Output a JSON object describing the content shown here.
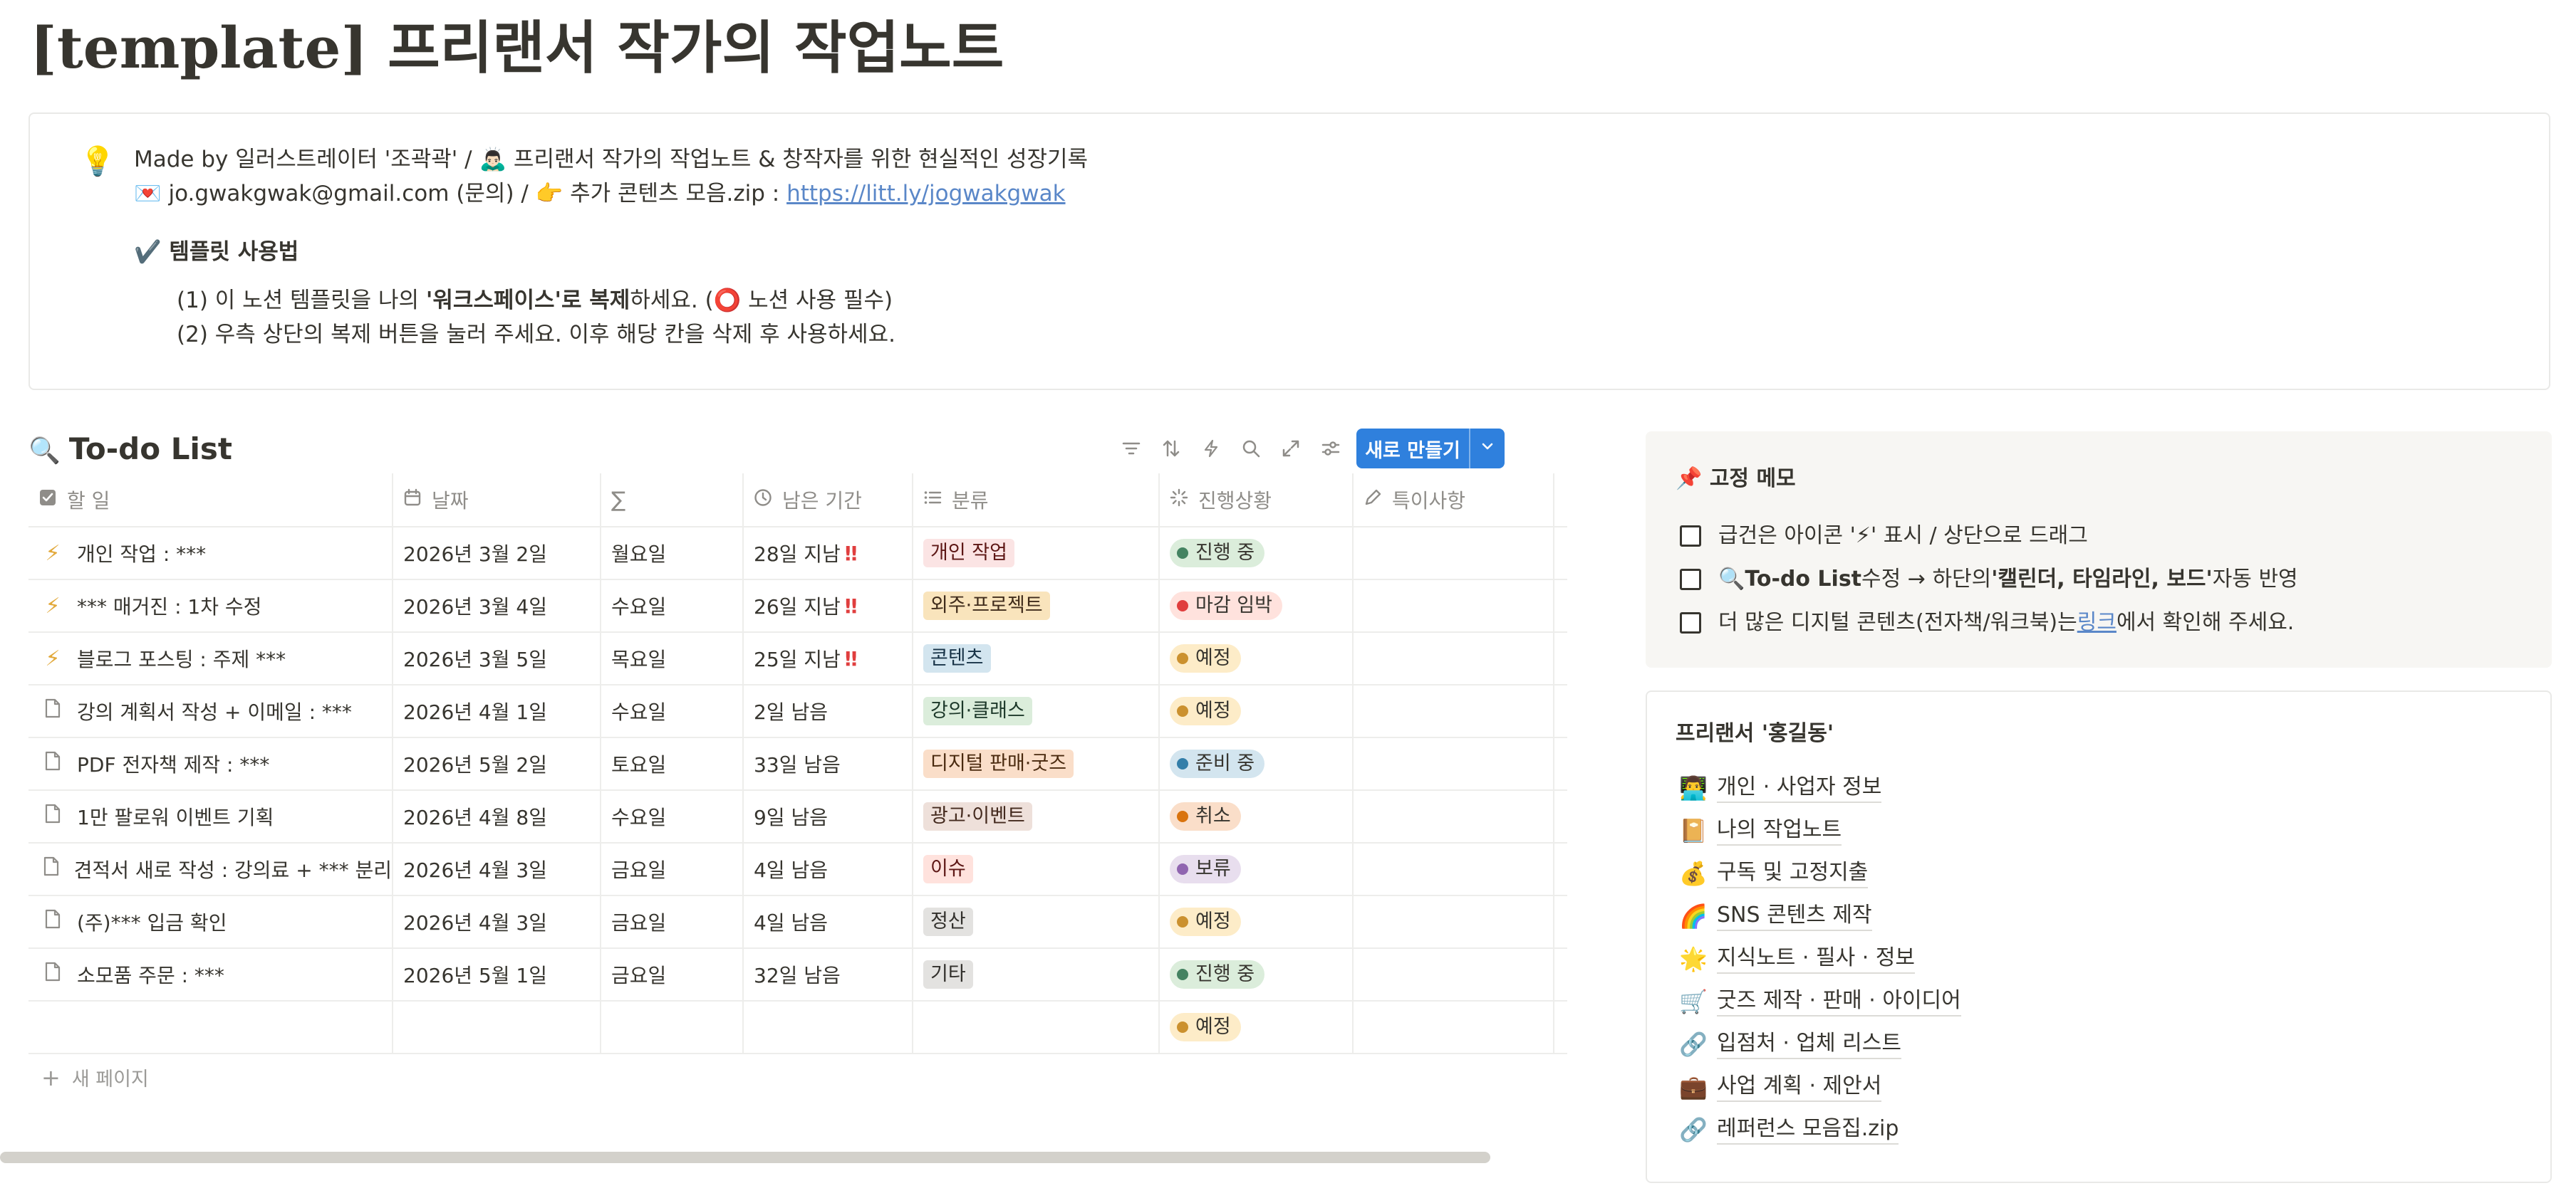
{
  "page": {
    "title": "[template] 프리랜서 작가의 작업노트"
  },
  "callout": {
    "icon": "💡",
    "line1": "Made by 일러스트레이터 '조곽곽' / 🙇🏻‍♂️ 프리랜서 작가의 작업노트 & 창작자를 위한 현실적인 성장기록",
    "line2_prefix": "💌 jo.gwakgwak@gmail.com (문의) / 👉 추가 콘텐츠 모음.zip : ",
    "line2_link": "https://litt.ly/jogwakgwak",
    "guide_title": "✔️ 템플릿 사용법",
    "step1_a": "(1) 이 노션 템플릿을 나의 ",
    "step1_b": "'워크스페이스'로 복제",
    "step1_c": "하세요. (⭕ 노션 사용 필수)",
    "step2": "(2) 우측 상단의 복제 버튼을 눌러 주세요. 이후 해당 칸을 삭제 후 사용하세요."
  },
  "todo": {
    "icon": "🔍",
    "title": "To-do List",
    "toolbar_icons": [
      "filter-icon",
      "sort-icon",
      "bolt-icon",
      "search-icon",
      "expand-icon",
      "settings-icon"
    ],
    "new_button": "새로 만들기",
    "columns": [
      "할 일",
      "날짜",
      "∑",
      "남은 기간",
      "분류",
      "진행상황",
      "특이사항"
    ],
    "rows": [
      {
        "icon": "bolt",
        "task": "개인 작업 : ***",
        "date": "2026년 3월 2일",
        "day": "월요일",
        "remain": "28일 지남",
        "urgent": true,
        "category": "개인 작업",
        "status": "진행 중"
      },
      {
        "icon": "bolt",
        "task": "*** 매거진 : 1차 수정",
        "date": "2026년 3월 4일",
        "day": "수요일",
        "remain": "26일 지남",
        "urgent": true,
        "category": "외주·프로젝트",
        "status": "마감 임박"
      },
      {
        "icon": "bolt",
        "task": "블로그 포스팅 : 주제 ***",
        "date": "2026년 3월 5일",
        "day": "목요일",
        "remain": "25일 지남",
        "urgent": true,
        "category": "콘텐츠",
        "status": "예정"
      },
      {
        "icon": "doc",
        "task": "강의 계획서 작성 + 이메일 : ***",
        "date": "2026년 4월 1일",
        "day": "수요일",
        "remain": "2일 남음",
        "urgent": false,
        "category": "강의·클래스",
        "status": "예정"
      },
      {
        "icon": "doc",
        "task": "PDF 전자책 제작 : ***",
        "date": "2026년 5월 2일",
        "day": "토요일",
        "remain": "33일 남음",
        "urgent": false,
        "category": "디지털 판매·굿즈",
        "status": "준비 중"
      },
      {
        "icon": "doc",
        "task": "1만 팔로워 이벤트 기획",
        "date": "2026년 4월 8일",
        "day": "수요일",
        "remain": "9일 남음",
        "urgent": false,
        "category": "광고·이벤트",
        "status": "취소"
      },
      {
        "icon": "doc",
        "task": "견적서 새로 작성 : 강의료 + *** 분리",
        "date": "2026년 4월 3일",
        "day": "금요일",
        "remain": "4일 남음",
        "urgent": false,
        "category": "이슈",
        "status": "보류"
      },
      {
        "icon": "doc",
        "task": "(주)*** 입금 확인",
        "date": "2026년 4월 3일",
        "day": "금요일",
        "remain": "4일 남음",
        "urgent": false,
        "category": "정산",
        "status": "예정"
      },
      {
        "icon": "doc",
        "task": "소모품 주문 : ***",
        "date": "2026년 5월 1일",
        "day": "금요일",
        "remain": "32일 남음",
        "urgent": false,
        "category": "기타",
        "status": "진행 중"
      },
      {
        "icon": "",
        "task": "",
        "date": "",
        "day": "",
        "remain": "",
        "urgent": false,
        "category": "",
        "status": "예정"
      }
    ],
    "new_page": "새 페이지",
    "category_colors": {
      "개인 작업": {
        "bg": "#fbe4e4",
        "fg": "#5d1715"
      },
      "외주·프로젝트": {
        "bg": "#f9e4bc",
        "fg": "#402c1b"
      },
      "콘텐츠": {
        "bg": "#d3e5ef",
        "fg": "#183347"
      },
      "강의·클래스": {
        "bg": "#dbeddb",
        "fg": "#1c3829"
      },
      "디지털 판매·굿즈": {
        "bg": "#fadec9",
        "fg": "#49290e"
      },
      "광고·이벤트": {
        "bg": "#eee0da",
        "fg": "#442a1e"
      },
      "이슈": {
        "bg": "#ffe2dd",
        "fg": "#5d1715"
      },
      "정산": {
        "bg": "#e3e2e0",
        "fg": "#32302c"
      },
      "기타": {
        "bg": "#e3e2e0",
        "fg": "#32302c"
      }
    },
    "status_colors": {
      "진행 중": {
        "bg": "#dbeddb",
        "dot": "#448361"
      },
      "마감 임박": {
        "bg": "#ffe2dd",
        "dot": "#e03e3e"
      },
      "예정": {
        "bg": "#fdecc8",
        "dot": "#cb912f"
      },
      "준비 중": {
        "bg": "#d3e5ef",
        "dot": "#337ea9"
      },
      "취소": {
        "bg": "#fadec9",
        "dot": "#d9730d"
      },
      "보류": {
        "bg": "#e8deee",
        "dot": "#9065b0"
      }
    }
  },
  "memo": {
    "icon": "📌",
    "title": "고정 메모",
    "item1": "급건은 아이콘 '⚡' 표시 / 상단으로 드래그",
    "item2_a": "🔍 ",
    "item2_b": "To-do List",
    "item2_c": " 수정 → 하단의 ",
    "item2_d": "'캘린더, 타임라인, 보드'",
    "item2_e": " 자동 반영",
    "item3_a": "더 많은 디지털 콘텐츠(전자책/워크북)는 ",
    "item3_link": "링크",
    "item3_b": "에서 확인해 주세요."
  },
  "profile": {
    "title": "프리랜서 '홍길동'",
    "links": [
      {
        "emoji": "👨‍💻",
        "label": "개인 · 사업자 정보"
      },
      {
        "emoji": "📔",
        "label": "나의 작업노트"
      },
      {
        "emoji": "💰",
        "label": "구독 및 고정지출"
      },
      {
        "emoji": "🌈",
        "label": "SNS 콘텐츠 제작"
      },
      {
        "emoji": "🌟",
        "label": "지식노트 · 필사 · 정보"
      },
      {
        "emoji": "🛒",
        "label": "굿즈 제작 · 판매 · 아이디어"
      },
      {
        "emoji": "🔗",
        "label": "입점처 · 업체 리스트"
      },
      {
        "emoji": "💼",
        "label": "사업 계획 · 제안서"
      },
      {
        "emoji": "🔗",
        "label": "레퍼런스 모음집.zip"
      }
    ]
  }
}
